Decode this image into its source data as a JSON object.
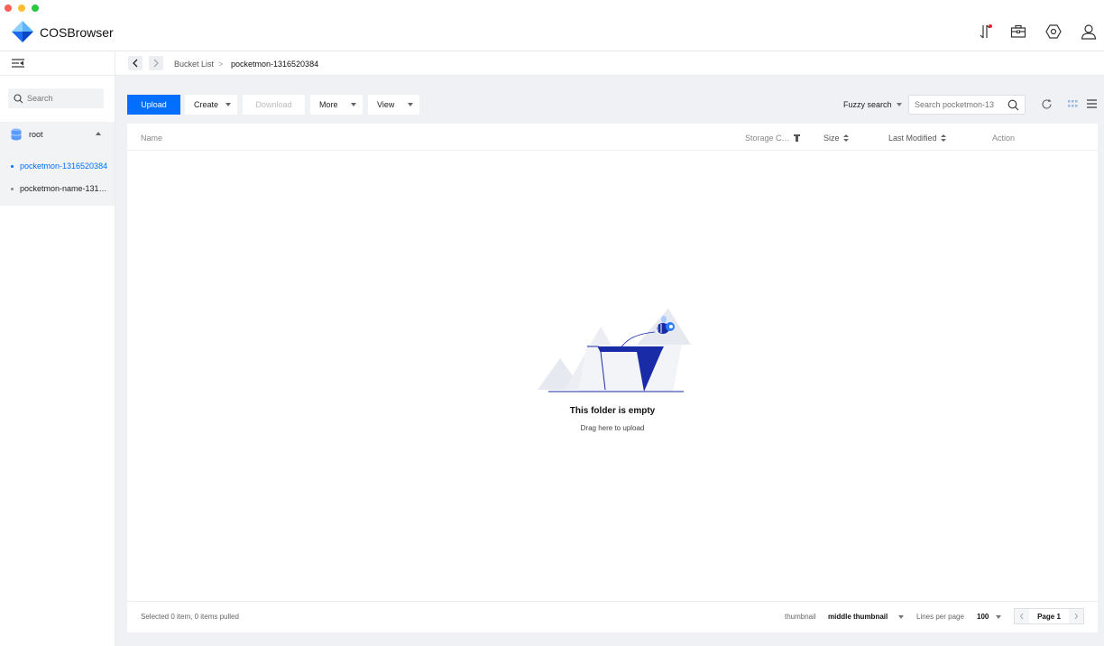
{
  "app": {
    "name": "COSBrowser"
  },
  "sidebar": {
    "search_placeholder": "Search",
    "root_label": "root",
    "buckets": [
      {
        "label": "pocketmon-1316520384",
        "active": true
      },
      {
        "label": "pocketmon-name-131…",
        "active": false
      }
    ]
  },
  "breadcrumb": {
    "items": [
      "Bucket List",
      "pocketmon-1316520384"
    ],
    "separator": ">"
  },
  "toolbar": {
    "upload": "Upload",
    "create": "Create",
    "download": "Download",
    "more": "More",
    "view": "View",
    "search_mode": "Fuzzy search",
    "search_placeholder": "Search pocketmon-13"
  },
  "table": {
    "columns": {
      "name": "Name",
      "storage_class": "Storage C…",
      "size": "Size",
      "last_modified": "Last Modified",
      "action": "Action"
    },
    "empty_title": "This folder is empty",
    "empty_subtitle": "Drag here to upload"
  },
  "footer": {
    "selection": "Selected 0 item, 0 items pulled",
    "thumbnail_label": "thumbnail",
    "thumbnail_value": "middle thumbnail",
    "lines_label": "Lines per page",
    "lines_value": "100",
    "page_label": "Page 1"
  },
  "colors": {
    "accent": "#006eff",
    "illustration": "#1a2ba8",
    "notification_dot": "#e5262f"
  }
}
